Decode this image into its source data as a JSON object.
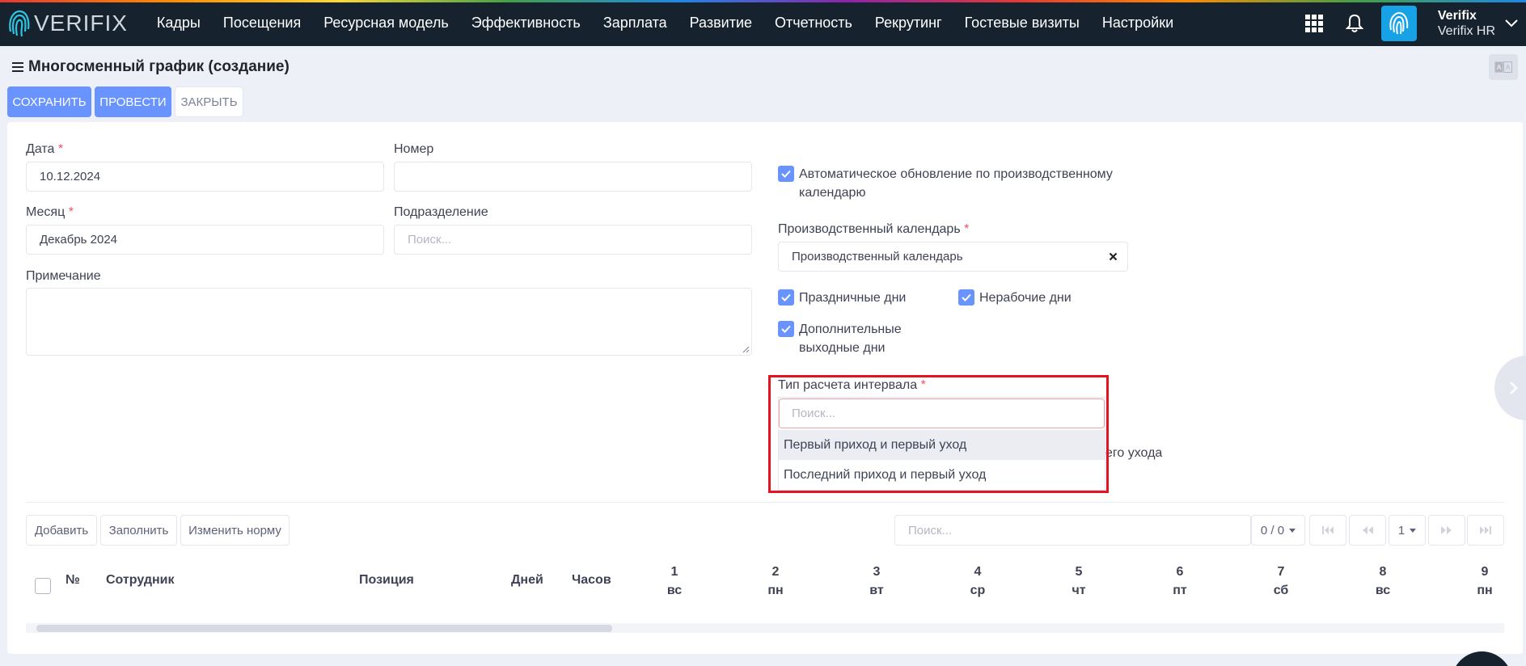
{
  "brand": {
    "logo_text": "VERIFIX"
  },
  "nav": [
    "Кадры",
    "Посещения",
    "Ресурсная модель",
    "Эффективность",
    "Зарплата",
    "Развитие",
    "Отчетность",
    "Рекрутинг",
    "Гостевые визиты",
    "Настройки"
  ],
  "user": {
    "name": "Verifix",
    "company": "Verifix HR"
  },
  "page": {
    "title": "Многосменный график (создание)",
    "lang_toggle": "A̶A"
  },
  "actions": {
    "save": "СОХРАНИТЬ",
    "post": "ПРОВЕСТИ",
    "close": "ЗАКРЫТЬ"
  },
  "form": {
    "date_label": "Дата",
    "date_value": "10.12.2024",
    "number_label": "Номер",
    "number_value": "",
    "month_label": "Месяц",
    "month_value": "Декабрь 2024",
    "division_label": "Подразделение",
    "division_placeholder": "Поиск...",
    "note_label": "Примечание",
    "required_mark": "*",
    "auto_update_line1": "Автоматическое обновление по производственному",
    "auto_update_line2": "календарю",
    "prod_calendar_label": "Производственный календарь",
    "prod_calendar_value": "Производственный календарь",
    "holidays": "Праздничные дни",
    "nonworking": "Нерабочие дни",
    "extra_days_line1": "Дополнительные",
    "extra_days_line2": "выходные дни",
    "interval_label": "Тип расчета интервала",
    "interval_placeholder": "Поиск...",
    "interval_options": [
      "Первый приход и первый уход",
      "Последний приход и первый уход"
    ],
    "partially_hidden": "его ухода"
  },
  "table_tools": {
    "add": "Добавить",
    "fill": "Заполнить",
    "change_norm": "Изменить норму",
    "search_placeholder": "Поиск...",
    "count": "0 / 0",
    "page": "1"
  },
  "table": {
    "headers": {
      "num": "№",
      "employee": "Сотрудник",
      "position": "Позиция",
      "days": "Дней",
      "hours": "Часов"
    },
    "day_columns": [
      {
        "d": "1",
        "w": "вс"
      },
      {
        "d": "2",
        "w": "пн"
      },
      {
        "d": "3",
        "w": "вт"
      },
      {
        "d": "4",
        "w": "ср"
      },
      {
        "d": "5",
        "w": "чт"
      },
      {
        "d": "6",
        "w": "пт"
      },
      {
        "d": "7",
        "w": "сб"
      },
      {
        "d": "8",
        "w": "вс"
      },
      {
        "d": "9",
        "w": "пн"
      }
    ]
  },
  "colors": {
    "primary": "#6993ff",
    "nav_bg": "#16222e",
    "highlight": "#e6121e",
    "required": "#f64e60"
  }
}
